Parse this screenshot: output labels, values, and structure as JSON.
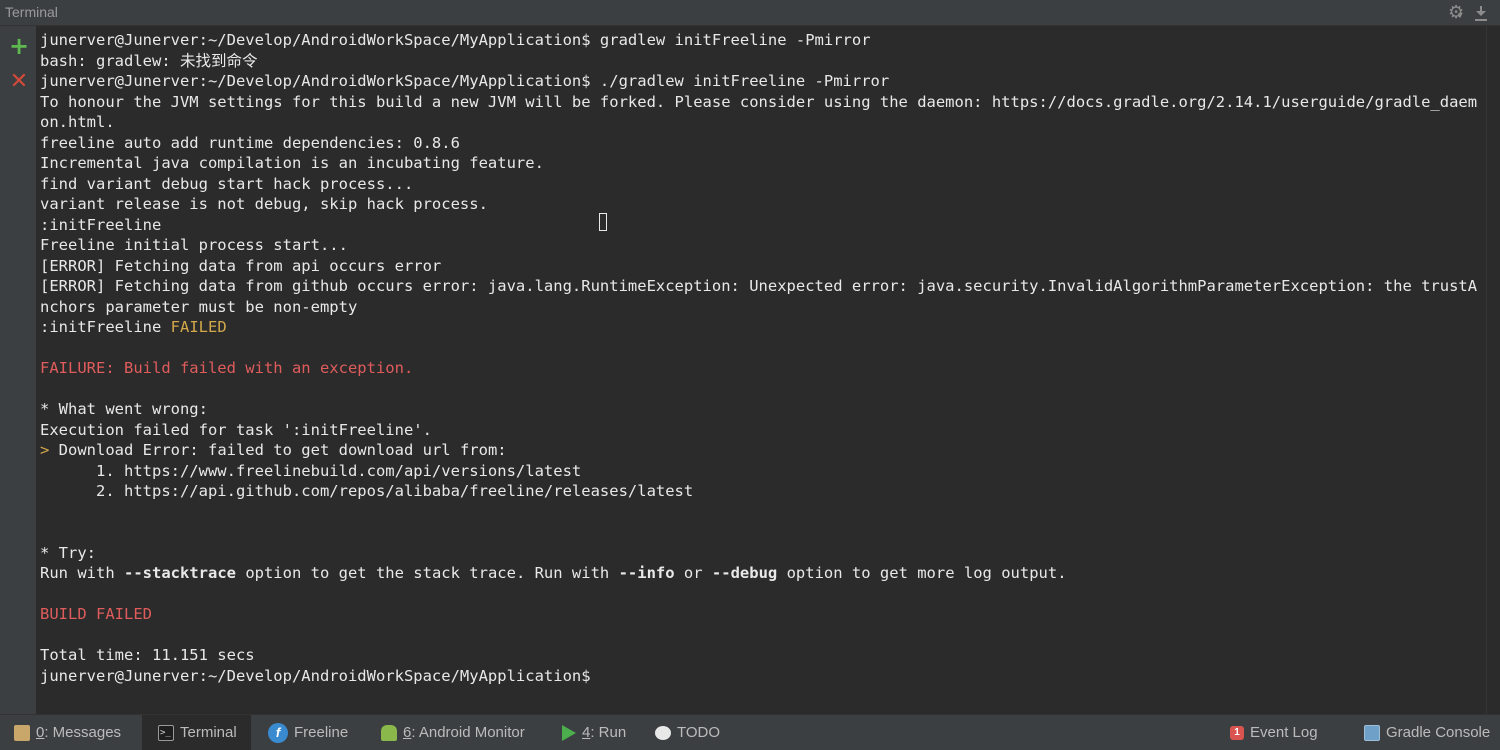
{
  "window": {
    "title": "Terminal"
  },
  "titlebar_icons": {
    "settings_icon": "gear-icon",
    "hide_icon": "download-icon"
  },
  "gutter": {
    "new_session_icon": "plus-icon",
    "close_session_icon": "close-icon",
    "new_glyph": "+",
    "close_glyph": "✕"
  },
  "terminal": {
    "lines": [
      {
        "text": "junerver@Junerver:~/Develop/AndroidWorkSpace/MyApplication$ gradlew initFreeline -Pmirror"
      },
      {
        "text": "bash: gradlew: 未找到命令"
      },
      {
        "text": "junerver@Junerver:~/Develop/AndroidWorkSpace/MyApplication$ ./gradlew initFreeline -Pmirror"
      },
      {
        "text": "To honour the JVM settings for this build a new JVM will be forked. Please consider using the daemon: https://docs.gradle.org/2.14.1/userguide/gradle_daem"
      },
      {
        "text": "on.html."
      },
      {
        "text": "freeline auto add runtime dependencies: 0.8.6"
      },
      {
        "text": "Incremental java compilation is an incubating feature."
      },
      {
        "text": "find variant debug start hack process..."
      },
      {
        "text": "variant release is not debug, skip hack process."
      },
      {
        "text": ":initFreeline"
      },
      {
        "text": "Freeline initial process start..."
      },
      {
        "text": "[ERROR] Fetching data from api occurs error"
      },
      {
        "text": "[ERROR] Fetching data from github occurs error: java.lang.RuntimeException: Unexpected error: java.security.InvalidAlgorithmParameterException: the trustA"
      },
      {
        "text": "nchors parameter must be non-empty"
      },
      {
        "prefix": ":initFreeline ",
        "suffix": "FAILED"
      },
      {
        "text": ""
      },
      {
        "red": "FAILURE: Build failed with an exception."
      },
      {
        "text": ""
      },
      {
        "text": "* What went wrong:"
      },
      {
        "text": "Execution failed for task ':initFreeline'."
      },
      {
        "gt": ">",
        "rest": " Download Error: failed to get download url from:"
      },
      {
        "text": "      1. https://www.freelinebuild.com/api/versions/latest"
      },
      {
        "text": "      2. https://api.github.com/repos/alibaba/freeline/releases/latest"
      },
      {
        "text": ""
      },
      {
        "text": ""
      },
      {
        "text": "* Try:"
      },
      {
        "parts": [
          {
            "t": "Run with ",
            "b": false
          },
          {
            "t": "--stacktrace",
            "b": true
          },
          {
            "t": " option to get the stack trace. Run with ",
            "b": false
          },
          {
            "t": "--info",
            "b": true
          },
          {
            "t": " or ",
            "b": false
          },
          {
            "t": "--debug",
            "b": true
          },
          {
            "t": " option to get more log output.",
            "b": false
          }
        ]
      },
      {
        "text": ""
      },
      {
        "red": "BUILD FAILED"
      },
      {
        "text": ""
      },
      {
        "text": "Total time: 11.151 secs"
      },
      {
        "text": "junerver@Junerver:~/Develop/AndroidWorkSpace/MyApplication$"
      }
    ]
  },
  "statusbar": {
    "left": [
      {
        "num": "0",
        "label": ": Messages",
        "icon": "messages-icon"
      },
      {
        "num": "",
        "label": "Terminal",
        "icon": "terminal-icon"
      },
      {
        "num": "",
        "label": "Freeline",
        "icon": "freeline-icon"
      },
      {
        "num": "6",
        "label": ": Android Monitor",
        "icon": "android-icon"
      },
      {
        "num": "4",
        "label": ": Run",
        "icon": "run-icon"
      },
      {
        "num": "",
        "label": "TODO",
        "icon": "todo-icon"
      }
    ],
    "right": [
      {
        "badge": "1",
        "label": "Event Log",
        "icon": "event-log-icon"
      },
      {
        "label": "Gradle Console",
        "icon": "gradle-console-icon"
      }
    ]
  },
  "colors": {
    "background": "#2b2b2b",
    "panel": "#3c3f41",
    "text": "#e8e8e8",
    "error_red": "#e05c5c",
    "warning_yellow": "#d2a84a"
  }
}
